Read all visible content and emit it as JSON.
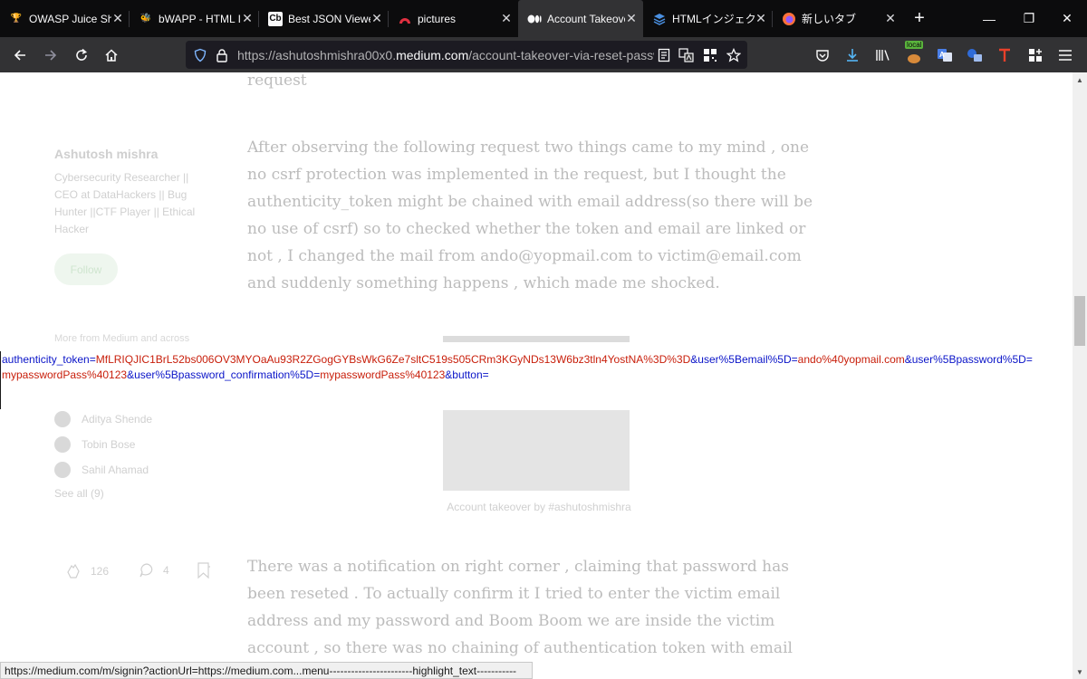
{
  "tabs": [
    {
      "title": "OWASP Juice Sho",
      "icon": "juice-shop-icon",
      "active": false
    },
    {
      "title": "bWAPP - HTML In",
      "icon": "bee-icon",
      "active": false
    },
    {
      "title": "Best JSON Viewer",
      "icon": "cb-icon",
      "favicon_text": "Cb",
      "active": false
    },
    {
      "title": "pictures",
      "icon": "pictures-icon",
      "active": false
    },
    {
      "title": "Account Takeover",
      "icon": "medium-icon",
      "active": true
    },
    {
      "title": "HTMLインジェクショ",
      "icon": "layers-icon",
      "active": false
    },
    {
      "title": "新しいタブ",
      "icon": "firefox-icon",
      "active": false
    }
  ],
  "close_glyph": "✕",
  "new_tab_glyph": "+",
  "window_controls": {
    "minimize": "—",
    "restore": "❐",
    "close": "✕"
  },
  "nav": {
    "url_prefix": "https://ashutoshmishra00x0.",
    "url_host": "medium.com",
    "url_path": "/account-takeover-via-reset-password",
    "extension_badge": "local"
  },
  "article": {
    "fragment_top": "request",
    "paragraph1": "After observing the following request two things came to my mind , one no csrf protection was implemented in the request, but I thought the authenticity_token might be chained with email address(so there will be no use of csrf) so to checked whether the token and email are linked or not , I changed the mail from ando@yopmail.com to victim@email.com and suddenly something happens , which made me shocked.",
    "image_caption": "Account takeover by #ashutoshmishra",
    "paragraph2": "There was a notification on right corner , claiming that password has been reseted . To actually confirm it I tried to enter the victim email address and my password and Boom Boom we are inside the victim account , so there was no chaining of authentication token with email address which lead me"
  },
  "sidebar": {
    "author_name": "Ashutosh mishra",
    "author_bio": "Cybersecurity Researcher || CEO at DataHackers || Bug Hunter ||CTF Player || Ethical Hacker",
    "follow_label": "Follow",
    "more_label": "More from Medium and across",
    "followers": [
      "Aditya Shende",
      "Tobin Bose",
      "Sahil Ahamad"
    ],
    "see_all": "See all (9)",
    "claps": "126",
    "responses": "4"
  },
  "overlay": {
    "line1": [
      {
        "t": "authenticity_token",
        "c": "k"
      },
      {
        "t": "=",
        "c": "k"
      },
      {
        "t": "MfLRIQJIC1BrL52bs006OV3MYOaAu93R2ZGogGYBsWkG6Ze7sltC519s505CRm3KGyNDs13W6bz3tln4YostNA%3D%3D",
        "c": "v"
      },
      {
        "t": "&user%5Bemail%5D",
        "c": "k"
      },
      {
        "t": "=",
        "c": "k"
      },
      {
        "t": "ando%40yopmail.com",
        "c": "v"
      },
      {
        "t": "&user%5Bpassword%5D",
        "c": "k"
      },
      {
        "t": "=",
        "c": "k"
      }
    ],
    "line2": [
      {
        "t": "mypasswordPass%40123",
        "c": "v"
      },
      {
        "t": "&user%5Bpassword_confirmation%5D",
        "c": "k"
      },
      {
        "t": "=",
        "c": "k"
      },
      {
        "t": "mypasswordPass%40123",
        "c": "v"
      },
      {
        "t": "&button",
        "c": "k"
      },
      {
        "t": "=",
        "c": "k"
      }
    ]
  },
  "status_text": "https://medium.com/m/signin?actionUrl=https://medium.com...menu-----------------------highlight_text-----------",
  "colors": {
    "key": "#0a14c8",
    "value": "#c81e0a",
    "tabbar": "#0c0c0d",
    "navbar": "#323234"
  }
}
